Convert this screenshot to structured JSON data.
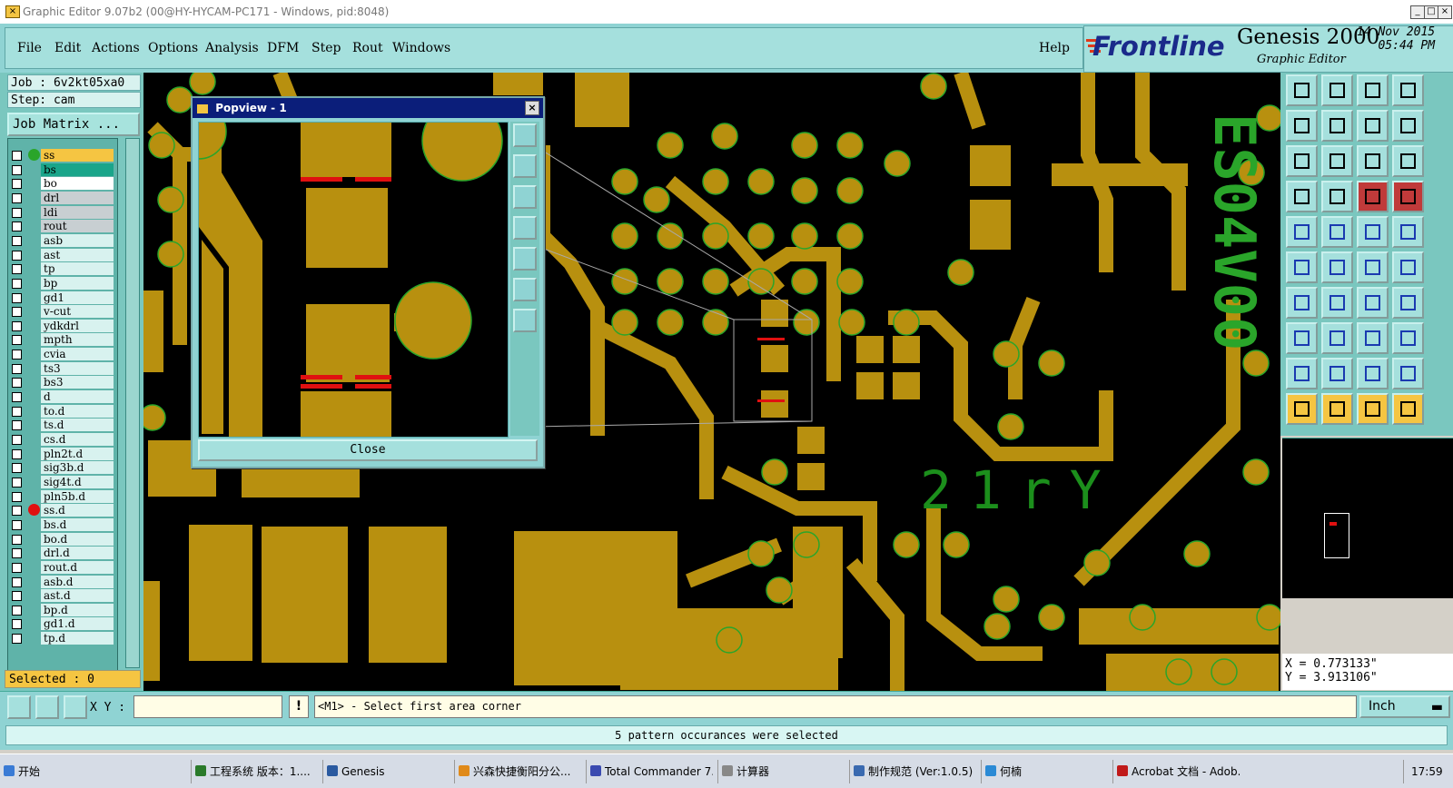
{
  "window": {
    "title": "Graphic Editor 9.07b2 (00@HY-HYCAM-PC171 - Windows, pid:8048)",
    "controls": [
      "_",
      "□",
      "×"
    ]
  },
  "menu": {
    "items": [
      "File",
      "Edit",
      "Actions",
      "Options",
      "Analysis",
      "DFM",
      "Step",
      "Rout",
      "Windows"
    ],
    "help": "Help"
  },
  "brand": {
    "logo": "Frontline",
    "product": "Genesis 2000",
    "module": "Graphic Editor",
    "date": "14 Nov 2015",
    "time": "05:44 PM"
  },
  "job": {
    "job_label": "Job : 6v2kt05xa0",
    "step_label": "Step: cam",
    "matrix_button": "Job Matrix ..."
  },
  "layers": [
    {
      "name": "ss",
      "bg": "#f5c542",
      "dot": "#2aa52a"
    },
    {
      "name": "bs",
      "bg": "#1aa58a",
      "dot": ""
    },
    {
      "name": "bo",
      "bg": "#ffffff",
      "dot": ""
    },
    {
      "name": "drl",
      "bg": "#c8cfd2",
      "dot": ""
    },
    {
      "name": "ldi",
      "bg": "#c8cfd2",
      "dot": ""
    },
    {
      "name": "rout",
      "bg": "#c8cfd2",
      "dot": ""
    },
    {
      "name": "asb",
      "bg": "#d8f2ef",
      "dot": ""
    },
    {
      "name": "ast",
      "bg": "#d8f2ef",
      "dot": ""
    },
    {
      "name": "tp",
      "bg": "#d8f2ef",
      "dot": ""
    },
    {
      "name": "bp",
      "bg": "#d8f2ef",
      "dot": ""
    },
    {
      "name": "gd1",
      "bg": "#d8f2ef",
      "dot": ""
    },
    {
      "name": "v-cut",
      "bg": "#d8f2ef",
      "dot": ""
    },
    {
      "name": "ydkdrl",
      "bg": "#d8f2ef",
      "dot": ""
    },
    {
      "name": "mpth",
      "bg": "#d8f2ef",
      "dot": ""
    },
    {
      "name": "cvia",
      "bg": "#d8f2ef",
      "dot": ""
    },
    {
      "name": "ts3",
      "bg": "#d8f2ef",
      "dot": ""
    },
    {
      "name": "bs3",
      "bg": "#d8f2ef",
      "dot": ""
    },
    {
      "name": "d",
      "bg": "#d8f2ef",
      "dot": ""
    },
    {
      "name": "to.d",
      "bg": "#d8f2ef",
      "dot": ""
    },
    {
      "name": "ts.d",
      "bg": "#d8f2ef",
      "dot": ""
    },
    {
      "name": "cs.d",
      "bg": "#d8f2ef",
      "dot": ""
    },
    {
      "name": "pln2t.d",
      "bg": "#d8f2ef",
      "dot": ""
    },
    {
      "name": "sig3b.d",
      "bg": "#d8f2ef",
      "dot": ""
    },
    {
      "name": "sig4t.d",
      "bg": "#d8f2ef",
      "dot": ""
    },
    {
      "name": "pln5b.d",
      "bg": "#d8f2ef",
      "dot": ""
    },
    {
      "name": "ss.d",
      "bg": "#d8f2ef",
      "dot": "#e01010"
    },
    {
      "name": "bs.d",
      "bg": "#d8f2ef",
      "dot": ""
    },
    {
      "name": "bo.d",
      "bg": "#d8f2ef",
      "dot": ""
    },
    {
      "name": "drl.d",
      "bg": "#d8f2ef",
      "dot": ""
    },
    {
      "name": "rout.d",
      "bg": "#d8f2ef",
      "dot": ""
    },
    {
      "name": "asb.d",
      "bg": "#d8f2ef",
      "dot": ""
    },
    {
      "name": "ast.d",
      "bg": "#d8f2ef",
      "dot": ""
    },
    {
      "name": "bp.d",
      "bg": "#d8f2ef",
      "dot": ""
    },
    {
      "name": "gd1.d",
      "bg": "#d8f2ef",
      "dot": ""
    },
    {
      "name": "tp.d",
      "bg": "#d8f2ef",
      "dot": ""
    }
  ],
  "selected_label": "Selected : 0",
  "popview": {
    "title": "Popview - 1",
    "close_label": "Close"
  },
  "canvas_text": {
    "vertical_label": "ES04V00",
    "silk_label": "21rY"
  },
  "coords": {
    "x": "X = 0.773133\"",
    "y": "Y = 3.913106\""
  },
  "command": {
    "xy_label": "X Y :",
    "xy_value": "",
    "prompt": "<M1> - Select first area corner",
    "unit": "Inch",
    "status": "5 pattern occurances were selected"
  },
  "colors": {
    "copper": "#b8900f",
    "silk": "#2aa52a",
    "accent": "#8fd3d3",
    "highlight": "#f5c542"
  },
  "taskbar": {
    "start": "开始",
    "tasks": [
      "工程系统 版本：1....",
      "Genesis",
      "兴森快捷衡阳分公...",
      "Total Commander 7.0...",
      "计算器",
      "制作规范 (Ver:1.0.5)",
      "何楠",
      "Acrobat 文档 - Adob..."
    ],
    "clock": "17:59"
  }
}
